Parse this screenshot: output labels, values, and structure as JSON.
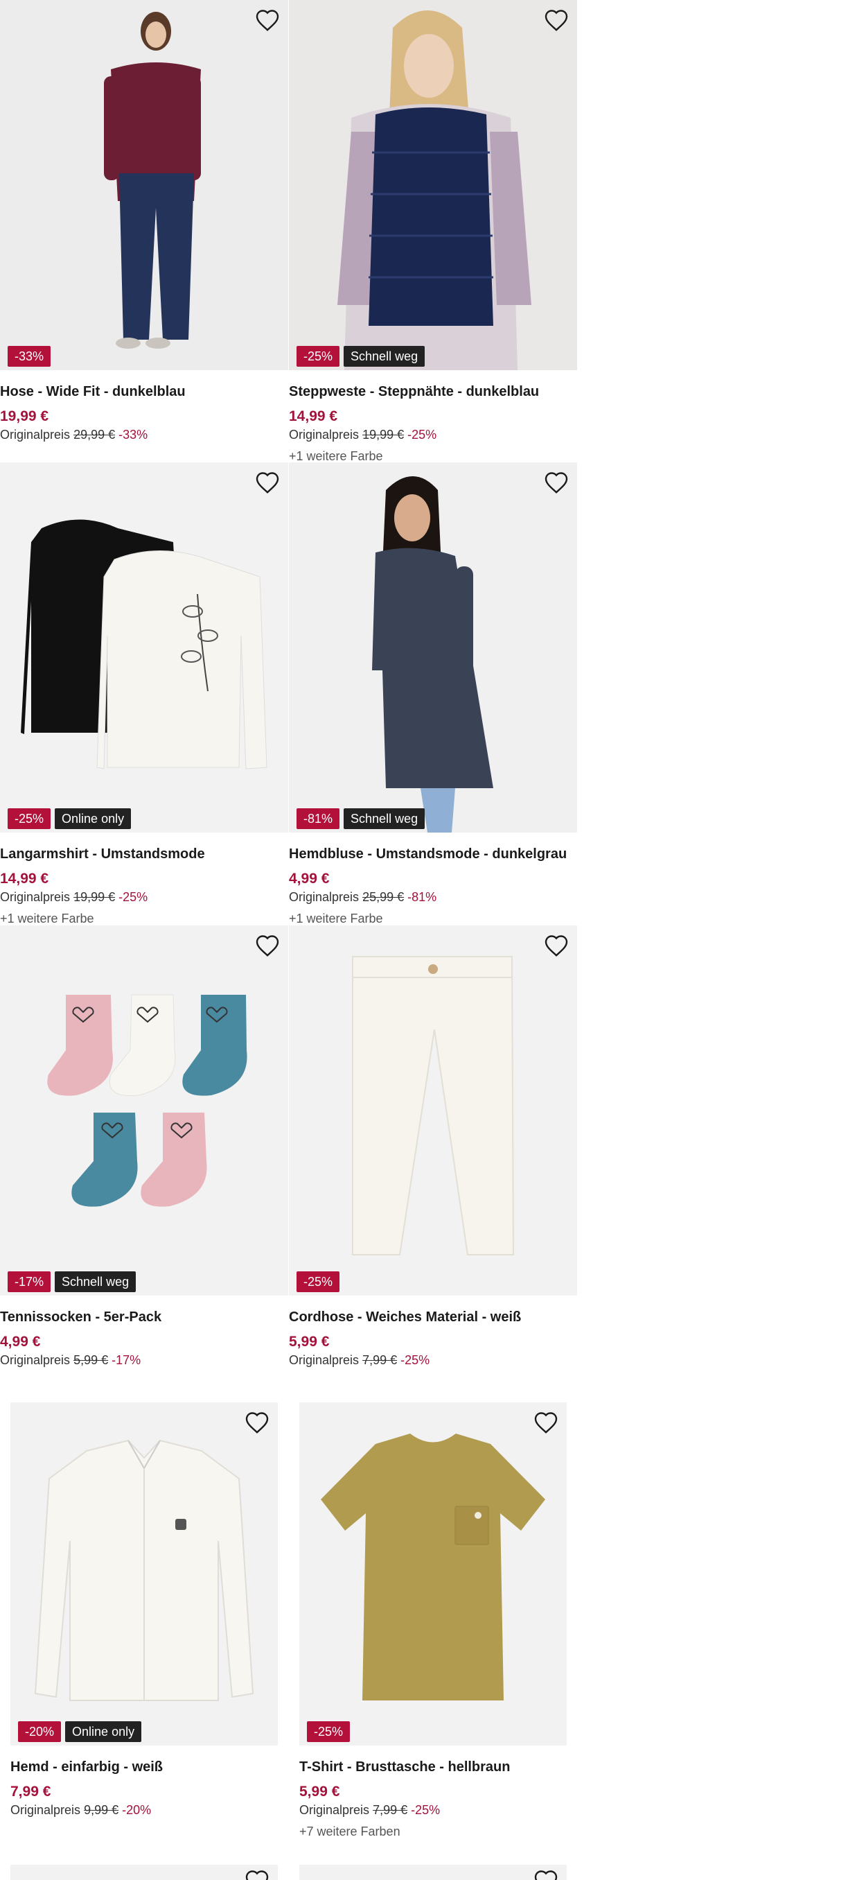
{
  "products": [
    {
      "title": "Hose - Wide Fit - dunkelblau",
      "price": "19,99 €",
      "orig_label": "Originalpreis",
      "orig_price": "29,99 €",
      "orig_pct": "-33%",
      "badges": [
        "-33%"
      ],
      "more": ""
    },
    {
      "title": "Steppweste - Steppnähte - dunkelblau",
      "price": "14,99 €",
      "orig_label": "Originalpreis",
      "orig_price": "19,99 €",
      "orig_pct": "-25%",
      "badges": [
        "-25%",
        "Schnell weg"
      ],
      "more": "+1 weitere Farbe"
    },
    {
      "title": "Langarmshirt - Umstandsmode",
      "price": "14,99 €",
      "orig_label": "Originalpreis",
      "orig_price": "19,99 €",
      "orig_pct": "-25%",
      "badges": [
        "-25%",
        "Online only"
      ],
      "more": "+1 weitere Farbe"
    },
    {
      "title": "Hemdbluse - Umstandsmode - dunkelgrau",
      "price": "4,99 €",
      "orig_label": "Originalpreis",
      "orig_price": "25,99 €",
      "orig_pct": "-81%",
      "badges": [
        "-81%",
        "Schnell weg"
      ],
      "more": "+1 weitere Farbe"
    },
    {
      "title": "Tennissocken - 5er-Pack",
      "price": "4,99 €",
      "orig_label": "Originalpreis",
      "orig_price": "5,99 €",
      "orig_pct": "-17%",
      "badges": [
        "-17%",
        "Schnell weg"
      ],
      "more": ""
    },
    {
      "title": "Cordhose - Weiches Material - weiß",
      "price": "5,99 €",
      "orig_label": "Originalpreis",
      "orig_price": "7,99 €",
      "orig_pct": "-25%",
      "badges": [
        "-25%"
      ],
      "more": ""
    },
    {
      "title": "Hemd - einfarbig - weiß",
      "price": "7,99 €",
      "orig_label": "Originalpreis",
      "orig_price": "9,99 €",
      "orig_pct": "-20%",
      "badges": [
        "-20%",
        "Online only"
      ],
      "more": ""
    },
    {
      "title": "T-Shirt - Brusttasche - hellbraun",
      "price": "5,99 €",
      "orig_label": "Originalpreis",
      "orig_price": "7,99 €",
      "orig_pct": "-25%",
      "badges": [
        "-25%"
      ],
      "more": "+7 weitere Farben"
    }
  ],
  "icons": {
    "favorite": "heart-outline-icon"
  },
  "colors": {
    "discount": "#b3113a",
    "price": "#a3123a",
    "dark_badge": "#222222",
    "image_bg": "#f2f2f2"
  }
}
